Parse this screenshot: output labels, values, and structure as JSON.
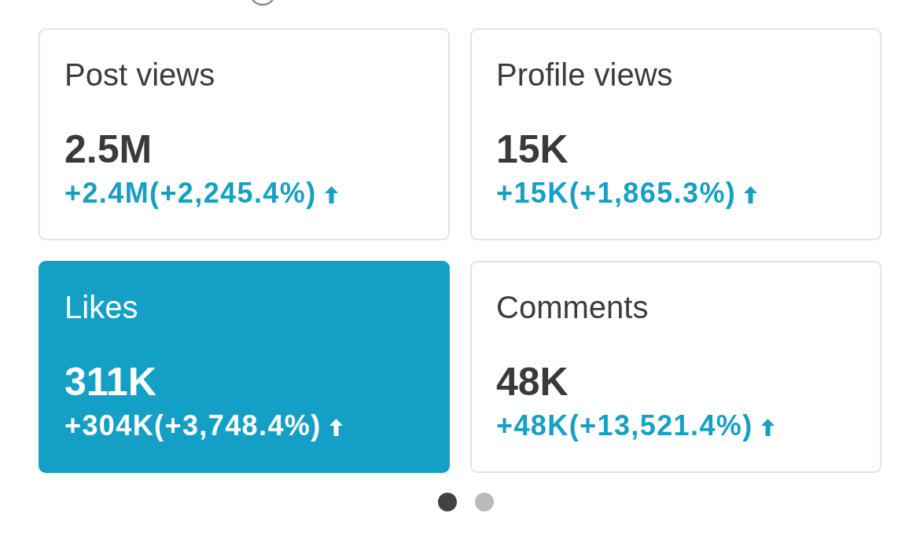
{
  "cards": [
    {
      "label": "Post views",
      "value": "2.5M",
      "change": "+2.4M(+2,245.4%)",
      "selected": false
    },
    {
      "label": "Profile views",
      "value": "15K",
      "change": "+15K(+1,865.3%)",
      "selected": false
    },
    {
      "label": "Likes",
      "value": "311K",
      "change": "+304K(+3,748.4%)",
      "selected": true
    },
    {
      "label": "Comments",
      "value": "48K",
      "change": "+48K(+13,521.4%)",
      "selected": false
    }
  ],
  "pager": [
    {
      "selected": true
    },
    {
      "selected": false
    }
  ]
}
